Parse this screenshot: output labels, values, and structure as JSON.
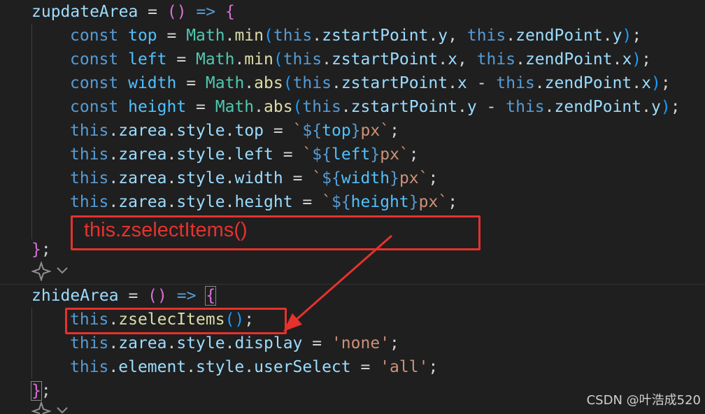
{
  "code": {
    "func1_name": "zupdateArea",
    "func2_name": "zhideArea",
    "kw_const": "const",
    "kw_this": "this",
    "math": "Math",
    "min": "min",
    "abs": "abs",
    "top": "top",
    "left": "left",
    "width": "width",
    "height": "height",
    "zstartPoint": "zstartPoint",
    "zendPoint": "zendPoint",
    "x": "x",
    "y": "y",
    "zarea": "zarea",
    "style": "style",
    "display": "display",
    "element": "element",
    "userSelect": "userSelect",
    "zselecItems": "zselecItems",
    "px": "px",
    "none_str": "'none'",
    "all_str": "'all'"
  },
  "annotation": {
    "note_text": "this.zselectItems()",
    "color": "#e5322d"
  },
  "watermark": "CSDN @叶浩成520",
  "icons": {
    "codelens": "sparkle-icon",
    "chevron": "chevron-down-icon"
  }
}
